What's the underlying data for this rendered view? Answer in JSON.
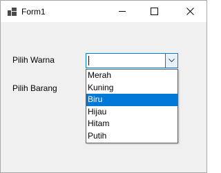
{
  "window": {
    "title": "Form1",
    "icon": "form-icon",
    "controls": [
      "minimize-icon",
      "maximize-icon",
      "close-icon"
    ]
  },
  "form": {
    "pilih_warna_label": "Pilih Warna",
    "pilih_barang_label": "Pilih Barang",
    "warna_combo": {
      "value": "",
      "options": [
        "Merah",
        "Kuning",
        "Biru",
        "Hijau",
        "Hitam",
        "Putih"
      ],
      "highlighted": "Biru"
    }
  },
  "colors": {
    "accent": "#0078d7",
    "window_bg": "#f0f0f0"
  }
}
